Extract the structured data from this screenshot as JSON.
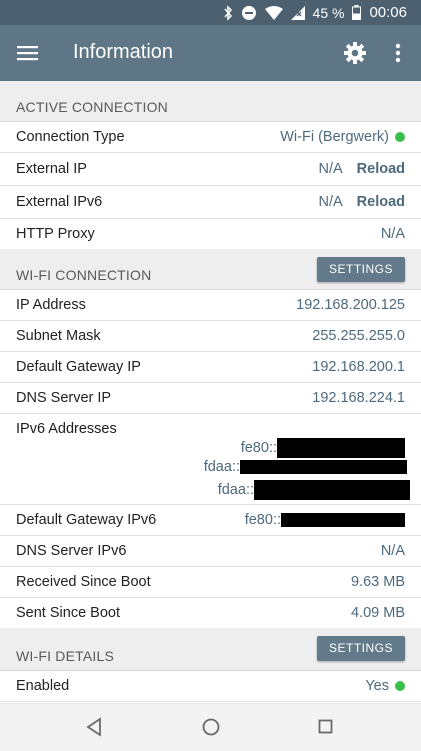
{
  "status_bar": {
    "battery": "45 %",
    "time": "00:06",
    "icons": [
      "bluetooth-icon",
      "dnd-icon",
      "wifi-icon",
      "signal-icon",
      "battery-icon"
    ]
  },
  "app_bar": {
    "title": "Information"
  },
  "active_connection": {
    "header": "ACTIVE CONNECTION",
    "rows": [
      {
        "key": "Connection Type",
        "value": "Wi-Fi (Bergwerk)"
      },
      {
        "key": "External IP",
        "value": "N/A",
        "action": "Reload"
      },
      {
        "key": "External IPv6",
        "value": "N/A",
        "action": "Reload"
      },
      {
        "key": "HTTP Proxy",
        "value": "N/A"
      }
    ]
  },
  "wifi_connection": {
    "header": "WI-FI CONNECTION",
    "button": "SETTINGS",
    "rows": [
      {
        "key": "IP Address",
        "value": "192.168.200.125"
      },
      {
        "key": "Subnet Mask",
        "value": "255.255.255.0"
      },
      {
        "key": "Default Gateway IP",
        "value": "192.168.200.1"
      },
      {
        "key": "DNS Server IP",
        "value": "192.168.224.1"
      }
    ],
    "ipv6": {
      "key": "IPv6 Addresses",
      "prefixes": [
        "fe80::",
        "fdaa::",
        "fdaa::"
      ]
    },
    "gateway_ipv6": {
      "key": "Default Gateway IPv6",
      "prefix": "fe80::"
    },
    "rows2": [
      {
        "key": "DNS Server IPv6",
        "value": "N/A"
      },
      {
        "key": "Received Since Boot",
        "value": "9.63 MB"
      },
      {
        "key": "Sent Since Boot",
        "value": "4.09 MB"
      }
    ]
  },
  "wifi_details": {
    "header": "WI-FI DETAILS",
    "button": "SETTINGS",
    "rows": [
      {
        "key": "Enabled",
        "value": "Yes"
      }
    ]
  },
  "colors": {
    "app_bar": "#5f7686",
    "status_bar": "#4d6070",
    "value_text": "#4d6a7c",
    "ok_dot": "#3bbf4a"
  }
}
